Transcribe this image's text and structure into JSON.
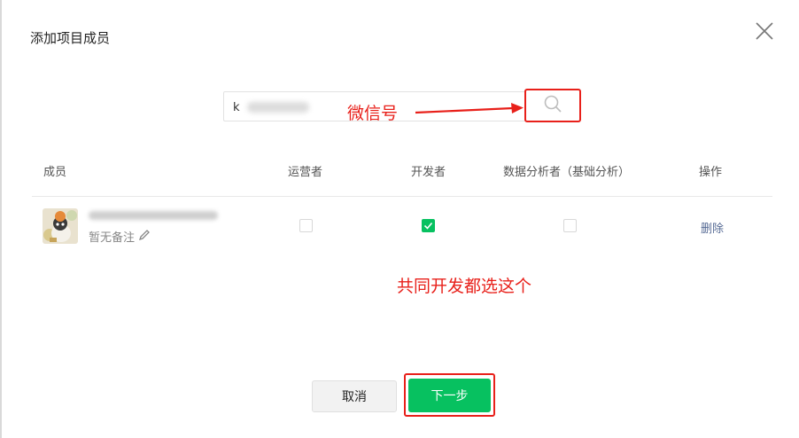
{
  "dialog": {
    "title": "添加项目成员",
    "close_icon": "close-icon"
  },
  "search": {
    "value": "k",
    "search_icon": "search-icon"
  },
  "annotations": {
    "wechat_id": "微信号",
    "all_developers": "共同开发都选这个",
    "color": "#e8201a"
  },
  "table": {
    "headers": {
      "member": "成员",
      "operator": "运营者",
      "developer": "开发者",
      "analyst": "数据分析者（基础分析）",
      "action": "操作"
    },
    "rows": [
      {
        "remark": "暂无备注",
        "edit_icon": "pencil-icon",
        "operator": false,
        "developer": true,
        "analyst": false,
        "delete_label": "删除"
      }
    ]
  },
  "footer": {
    "cancel_label": "取消",
    "next_label": "下一步"
  },
  "colors": {
    "primary": "#07c160",
    "link": "#576b95"
  }
}
